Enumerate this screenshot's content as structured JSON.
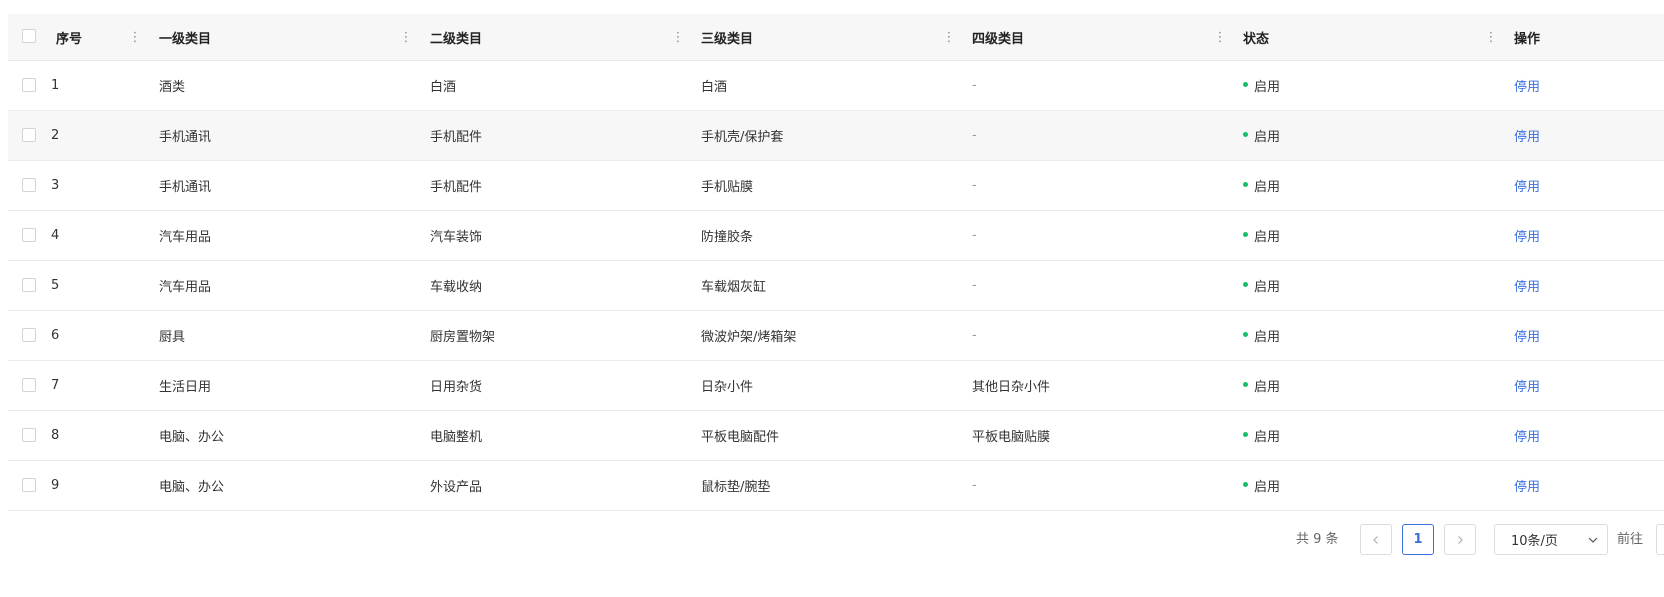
{
  "colors": {
    "accent": "#3b6fe0",
    "status_enabled": "#19be6b",
    "header_bg": "#f7f7f7",
    "hover_row_bg": "#f7f7f7"
  },
  "table": {
    "columns": [
      {
        "key": "index",
        "label": "序号"
      },
      {
        "key": "level1",
        "label": "一级类目"
      },
      {
        "key": "level2",
        "label": "二级类目"
      },
      {
        "key": "level3",
        "label": "三级类目"
      },
      {
        "key": "level4",
        "label": "四级类目"
      },
      {
        "key": "status",
        "label": "状态"
      },
      {
        "key": "action",
        "label": "操作"
      }
    ],
    "column_menu_icon": "more-vertical-icon",
    "rows": [
      {
        "index": "1",
        "level1": "酒类",
        "level2": "白酒",
        "level3": "白酒",
        "level4": "-",
        "status": "启用",
        "action": "停用"
      },
      {
        "index": "2",
        "level1": "手机通讯",
        "level2": "手机配件",
        "level3": "手机壳/保护套",
        "level4": "-",
        "status": "启用",
        "action": "停用"
      },
      {
        "index": "3",
        "level1": "手机通讯",
        "level2": "手机配件",
        "level3": "手机贴膜",
        "level4": "-",
        "status": "启用",
        "action": "停用"
      },
      {
        "index": "4",
        "level1": "汽车用品",
        "level2": "汽车装饰",
        "level3": "防撞胶条",
        "level4": "-",
        "status": "启用",
        "action": "停用"
      },
      {
        "index": "5",
        "level1": "汽车用品",
        "level2": "车载收纳",
        "level3": "车载烟灰缸",
        "level4": "-",
        "status": "启用",
        "action": "停用"
      },
      {
        "index": "6",
        "level1": "厨具",
        "level2": "厨房置物架",
        "level3": "微波炉架/烤箱架",
        "level4": "-",
        "status": "启用",
        "action": "停用"
      },
      {
        "index": "7",
        "level1": "生活日用",
        "level2": "日用杂货",
        "level3": "日杂小件",
        "level4": "其他日杂小件",
        "status": "启用",
        "action": "停用"
      },
      {
        "index": "8",
        "level1": "电脑、办公",
        "level2": "电脑整机",
        "level3": "平板电脑配件",
        "level4": "平板电脑贴膜",
        "status": "启用",
        "action": "停用"
      },
      {
        "index": "9",
        "level1": "电脑、办公",
        "level2": "外设产品",
        "level3": "鼠标垫/腕垫",
        "level4": "-",
        "status": "启用",
        "action": "停用"
      }
    ]
  },
  "pagination": {
    "total_text": "共 9 条",
    "prev_icon": "chevron-left-icon",
    "next_icon": "chevron-right-icon",
    "current_page": "1",
    "page_size": "10条/页",
    "page_size_icon": "chevron-down-icon",
    "goto_label": "前往"
  }
}
